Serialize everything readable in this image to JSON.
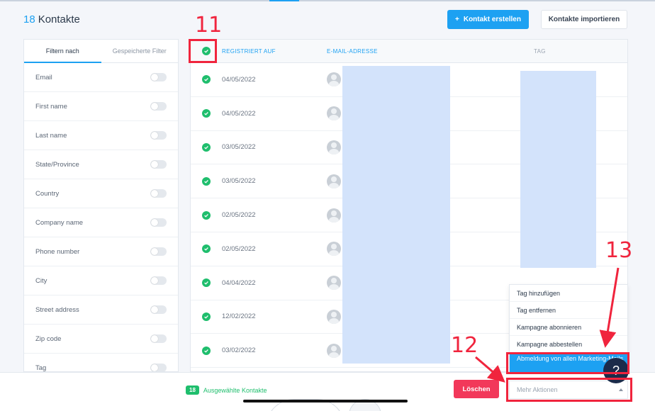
{
  "header": {
    "count": "18",
    "title": "Kontakte",
    "create_button": "Kontakt erstellen",
    "import_button": "Kontakte importieren"
  },
  "sidebar": {
    "tabs": [
      {
        "label": "Filtern nach",
        "active": true
      },
      {
        "label": "Gespeicherte Filter",
        "active": false
      }
    ],
    "filters": [
      "Email",
      "First name",
      "Last name",
      "State/Province",
      "Country",
      "Company name",
      "Phone number",
      "City",
      "Street address",
      "Zip code",
      "Tag"
    ]
  },
  "table": {
    "columns": {
      "registered": "REGISTRIERT AUF",
      "email": "E-MAIL-ADRESSE",
      "tag": "TAG"
    },
    "dates": [
      "04/05/2022",
      "04/05/2022",
      "03/05/2022",
      "03/05/2022",
      "02/05/2022",
      "02/05/2022",
      "04/04/2022",
      "12/02/2022",
      "03/02/2022"
    ]
  },
  "menu": {
    "items": [
      "Tag hinzufügen",
      "Tag entfernen",
      "Kampagne abonnieren",
      "Kampagne abbestellen",
      "Abmeldung von allen Marketing-Mails"
    ]
  },
  "bottombar": {
    "selected_count": "18",
    "selected_label": "Ausgewählte Kontakte",
    "delete_button": "Löschen",
    "more_actions_placeholder": "Mehr Aktionen"
  },
  "help": {
    "label": "?"
  },
  "annotations": {
    "n11": "11",
    "n12": "12",
    "n13": "13"
  },
  "colors": {
    "accent": "#1da1f2",
    "success": "#1fbe6d",
    "danger": "#f2385a",
    "annotation": "#f0243d"
  }
}
